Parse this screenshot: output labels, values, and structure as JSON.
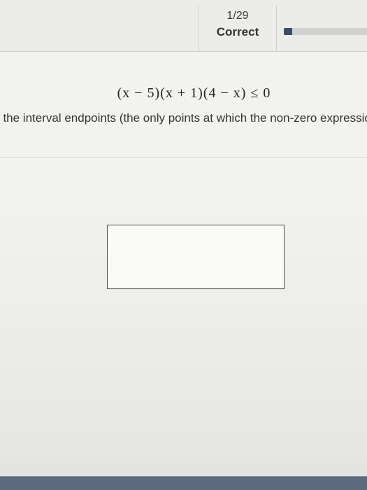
{
  "progress": {
    "counter": "1/29",
    "status": "Correct",
    "fraction": 0.04
  },
  "question": {
    "expression": "(x − 5)(x + 1)(4 − x) ≤ 0",
    "instruction": "t the interval endpoints (the only points at which the non-zero expression"
  },
  "answer": {
    "value": ""
  },
  "colors": {
    "progress_fill": "#3d4d69",
    "footer": "#5a6a7c"
  }
}
